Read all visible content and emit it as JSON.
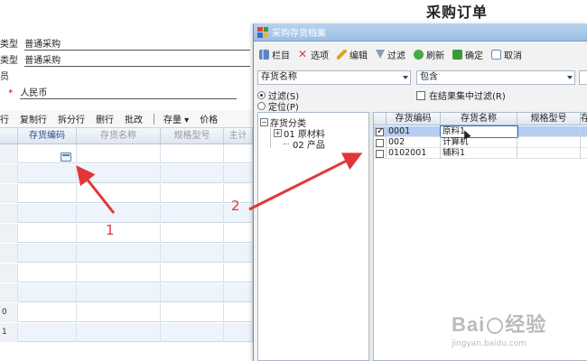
{
  "background_form": {
    "title": "采购订单",
    "fields": [
      {
        "label": "类型",
        "value": "普通采购"
      },
      {
        "label": "类型",
        "value": "普通采购"
      },
      {
        "label": "员",
        "value": ""
      },
      {
        "label": "*",
        "value": "人民币"
      }
    ],
    "toolbar": [
      "行",
      "复制行",
      "拆分行",
      "删行",
      "批改",
      "存量 ▾",
      "价格"
    ],
    "grid_headers": [
      "存货编码",
      "存货名称",
      "规格型号",
      "主计"
    ],
    "row_numbers": [
      "",
      "",
      "",
      "",
      "",
      "",
      "",
      "",
      "0",
      "1"
    ]
  },
  "dialog": {
    "title": "采购存货档案",
    "toolbar": [
      {
        "label": "栏目",
        "icon": "columns-icon"
      },
      {
        "label": "选项",
        "icon": "options-icon"
      },
      {
        "label": "编辑",
        "icon": "edit-icon"
      },
      {
        "label": "过滤",
        "icon": "filter-icon"
      },
      {
        "label": "刷新",
        "icon": "refresh-icon"
      },
      {
        "label": "确定",
        "icon": "confirm-icon"
      },
      {
        "label": "取消",
        "icon": "cancel-icon"
      }
    ],
    "filter_field": "存货名称",
    "filter_operator": "包含",
    "filter_value": "",
    "radio_filter": "过滤(S)",
    "radio_locate": "定位(P)",
    "in_result_filter": "在结果集中过滤(R)",
    "tree": {
      "root": "存货分类",
      "children": [
        "01 原材料",
        "02 产品"
      ]
    },
    "list_headers": [
      "",
      "存货编码",
      "存货名称",
      "规格型号",
      "存"
    ],
    "rows": [
      {
        "checked": true,
        "code": "0001",
        "name": "原料1",
        "spec": ""
      },
      {
        "checked": false,
        "code": "002",
        "name": "计算机",
        "spec": ""
      },
      {
        "checked": false,
        "code": "0102001",
        "name": "辅料1",
        "spec": ""
      }
    ]
  },
  "annotations": {
    "step1": "1",
    "step2": "2"
  },
  "watermark": {
    "brand_left": "Bai",
    "brand_right": "经验",
    "url": "jingyan.baidu.com"
  },
  "colors": {
    "arrow_red": "#e23636",
    "selected_row": "#b4cdf0",
    "dialog_title_bg": "#9dbfe4"
  }
}
